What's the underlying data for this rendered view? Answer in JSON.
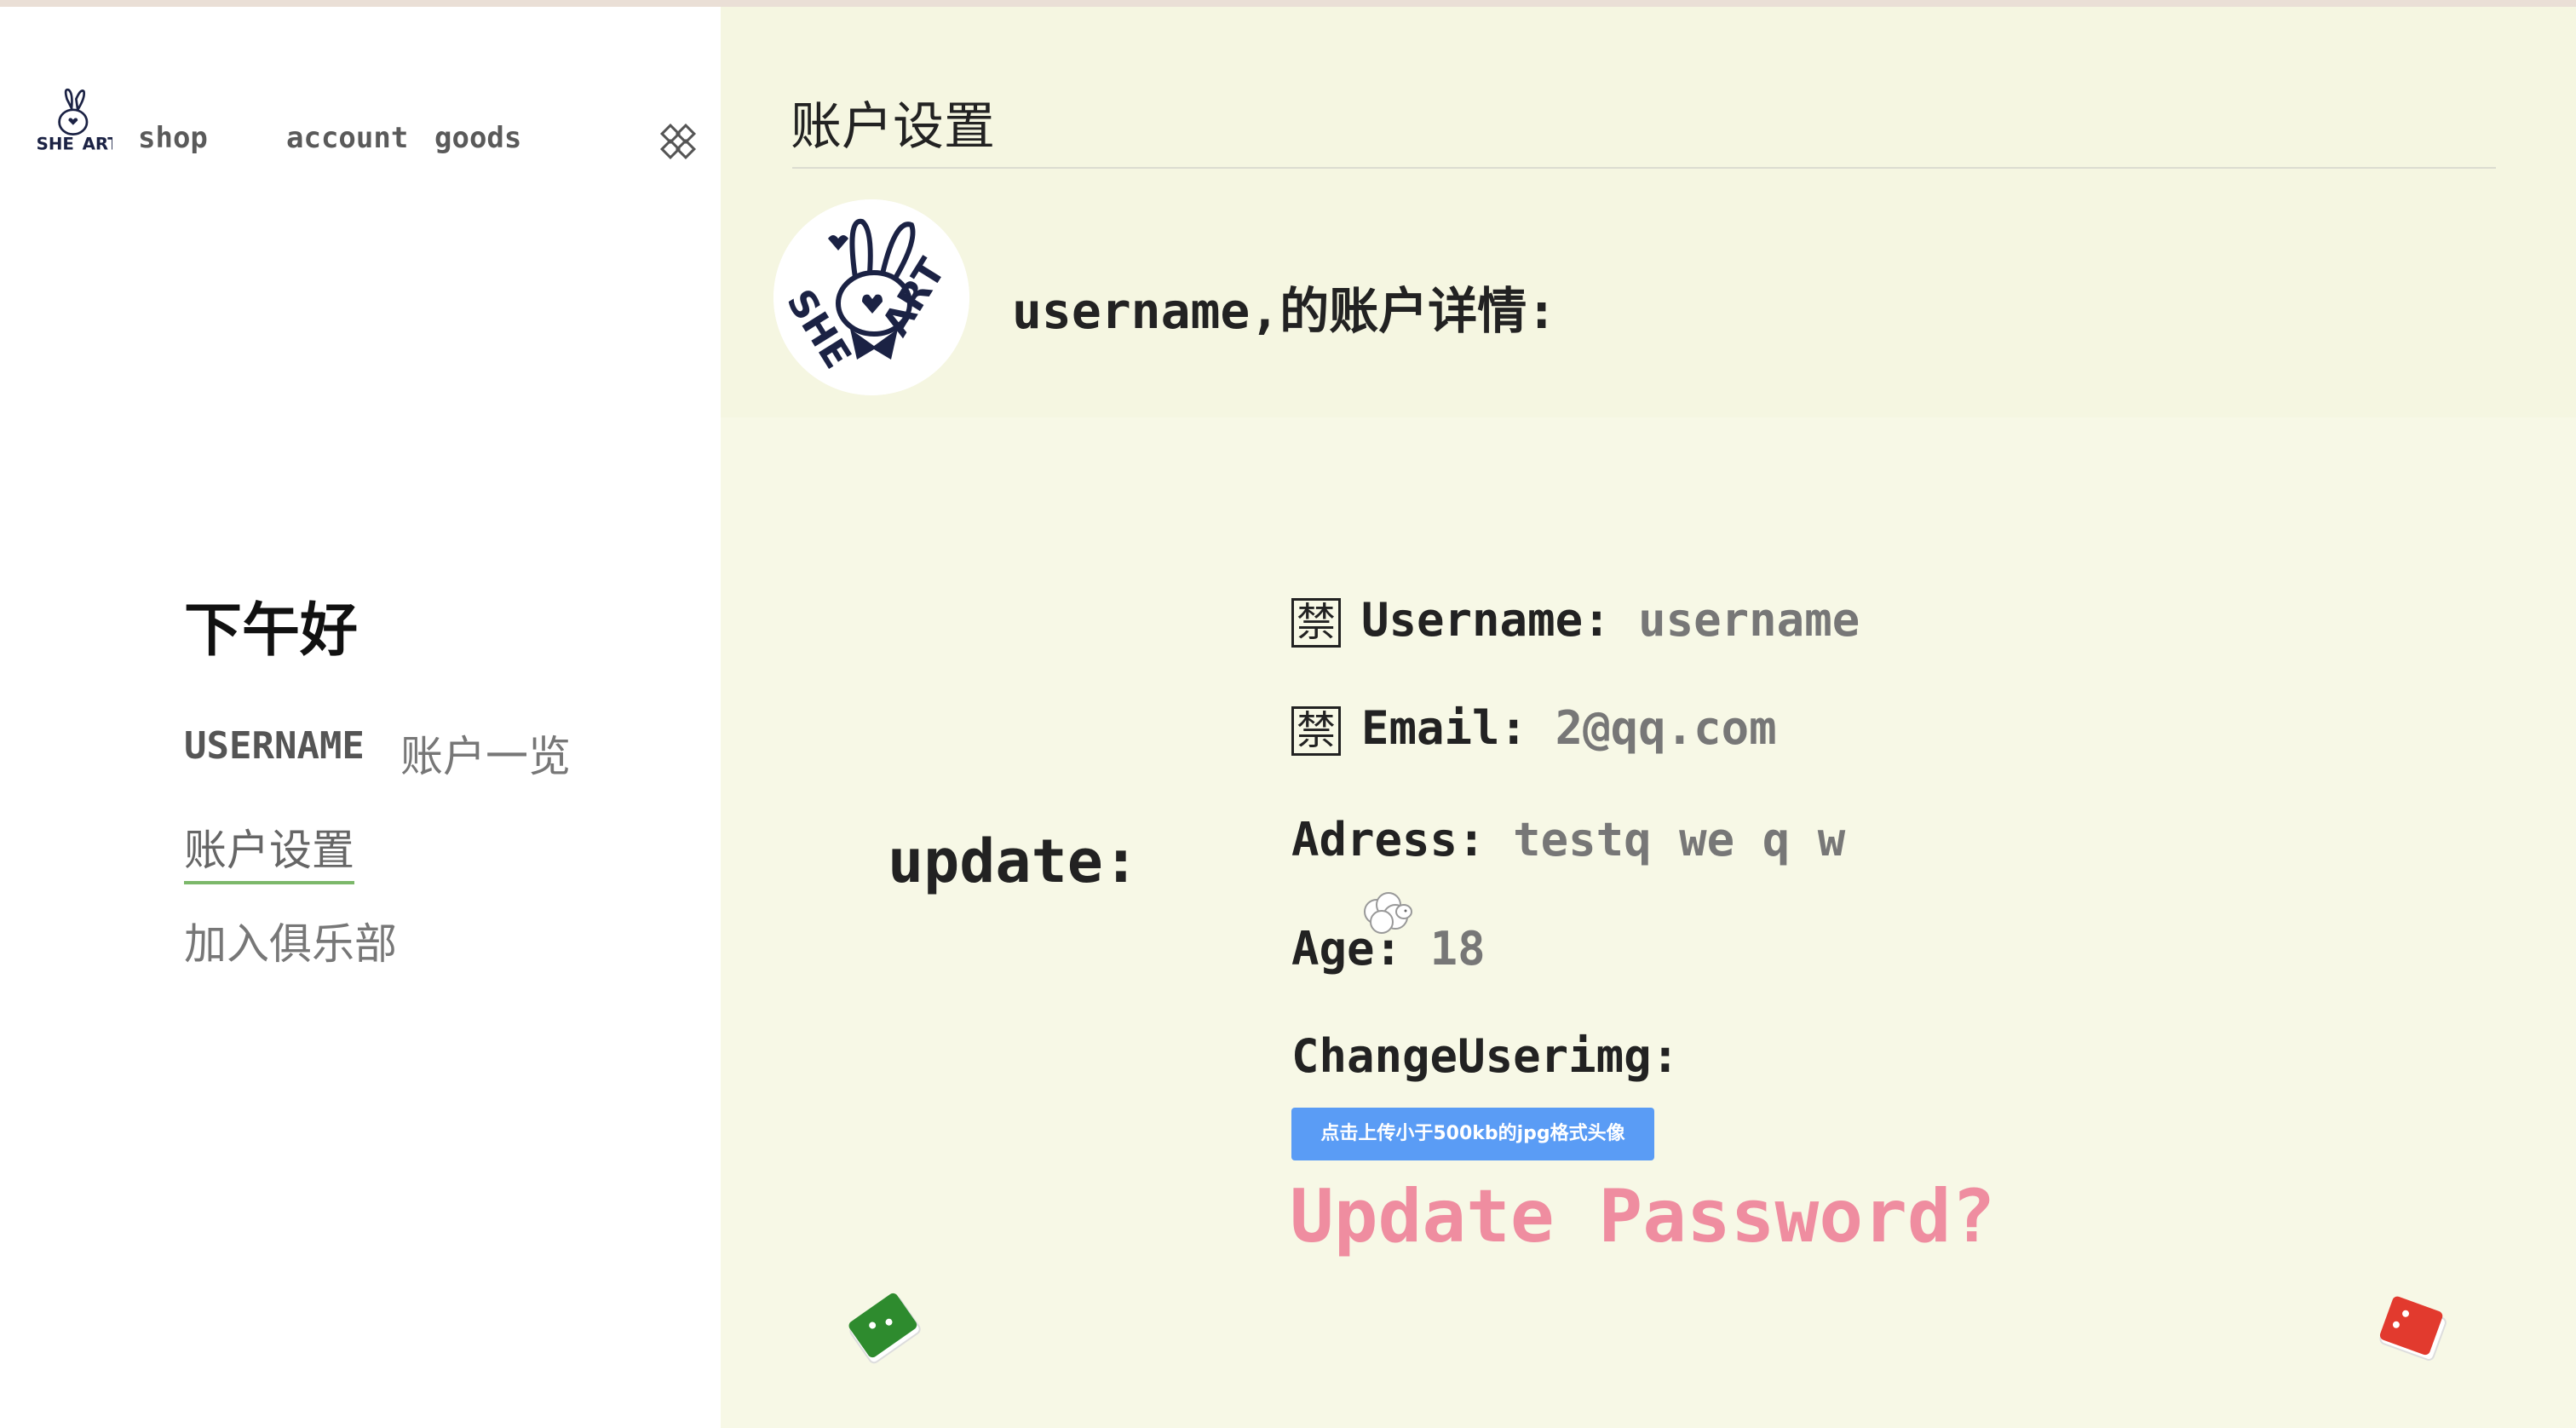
{
  "nav": {
    "logo": "SHEART",
    "items": [
      {
        "label": "shop"
      },
      {
        "label": "account"
      },
      {
        "label": "goods"
      }
    ],
    "collapse_icon": "collapse-icon"
  },
  "sidebar": {
    "greeting": "下午好",
    "username": "USERNAME",
    "menu": [
      {
        "label": "账户一览"
      },
      {
        "label": "账户设置",
        "active": true
      },
      {
        "label": "加入俱乐部"
      }
    ]
  },
  "main": {
    "title": "账户设置",
    "account_heading": "username,的账户详情:",
    "avatar_text": "SHEART",
    "update_label": "update:",
    "fields": {
      "forbid_mark": "禁",
      "username": {
        "label": "Username:",
        "value": "username",
        "locked": true
      },
      "email": {
        "label": "Email:",
        "value": "2@qq.com",
        "locked": true
      },
      "address": {
        "label": "Adress:",
        "value": "testq we q w"
      },
      "age": {
        "label": "Age:",
        "value": "18"
      },
      "change_img": {
        "label": "ChangeUserimg:"
      }
    },
    "upload_button": "点击上传小于500kb的jpg格式头像",
    "password_link": "Update Password?"
  },
  "colors": {
    "main_bg": "#f7f8e6",
    "upload_button": "#5a9cf5",
    "password_link": "#ef8da0",
    "active_underline": "#7cb86a",
    "deco_green": "#2e8b2e",
    "deco_red": "#e23a2e"
  }
}
